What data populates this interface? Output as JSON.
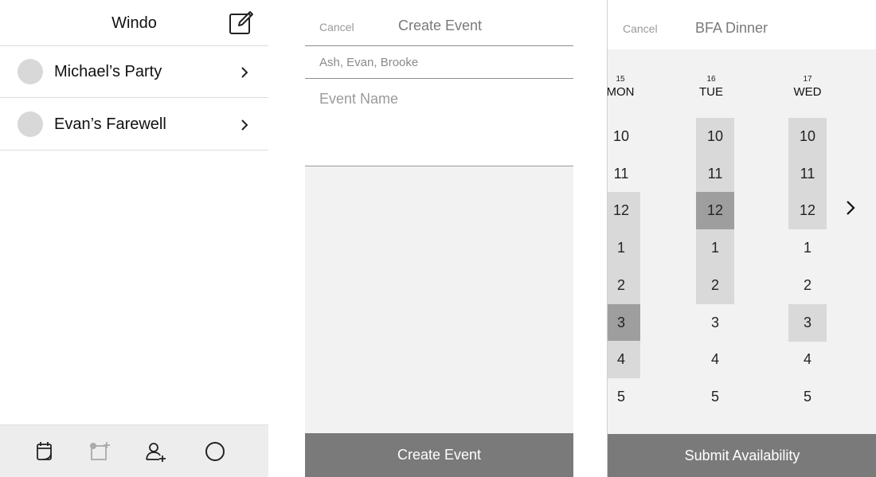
{
  "inbox": {
    "title": "Windo",
    "events": [
      {
        "name": "Michael’s Party"
      },
      {
        "name": "Evan’s Farewell"
      }
    ],
    "tabs": [
      {
        "icon": "calendar-icon"
      },
      {
        "icon": "add-event-icon"
      },
      {
        "icon": "add-person-icon"
      },
      {
        "icon": "circle-icon"
      }
    ]
  },
  "create_event": {
    "cancel_label": "Cancel",
    "title": "Create Event",
    "participants": "Ash, Evan, Brooke",
    "event_name_placeholder": "Event Name",
    "create_button": "Create Event"
  },
  "availability": {
    "cancel_label": "Cancel",
    "title": "BFA Dinner",
    "days": [
      {
        "num": "15",
        "name": "MON",
        "hours": [
          {
            "h": "10",
            "s": "none"
          },
          {
            "h": "11",
            "s": "none"
          },
          {
            "h": "12",
            "s": "available"
          },
          {
            "h": "1",
            "s": "available"
          },
          {
            "h": "2",
            "s": "available"
          },
          {
            "h": "3",
            "s": "selected"
          },
          {
            "h": "4",
            "s": "available"
          },
          {
            "h": "5",
            "s": "none"
          }
        ]
      },
      {
        "num": "16",
        "name": "TUE",
        "hours": [
          {
            "h": "10",
            "s": "available"
          },
          {
            "h": "11",
            "s": "available"
          },
          {
            "h": "12",
            "s": "selected"
          },
          {
            "h": "1",
            "s": "available"
          },
          {
            "h": "2",
            "s": "available"
          },
          {
            "h": "3",
            "s": "none"
          },
          {
            "h": "4",
            "s": "none"
          },
          {
            "h": "5",
            "s": "none"
          }
        ]
      },
      {
        "num": "17",
        "name": "WED",
        "hours": [
          {
            "h": "10",
            "s": "available"
          },
          {
            "h": "11",
            "s": "available"
          },
          {
            "h": "12",
            "s": "available"
          },
          {
            "h": "1",
            "s": "none"
          },
          {
            "h": "2",
            "s": "none"
          },
          {
            "h": "3",
            "s": "available"
          },
          {
            "h": "4",
            "s": "none"
          },
          {
            "h": "5",
            "s": "none"
          }
        ]
      }
    ],
    "submit_button": "Submit Availability"
  },
  "colors": {
    "button_bg": "#7a7a7a",
    "slot_available": "#d9d9d9",
    "slot_selected": "#9e9e9e",
    "panel_bg": "#f2f2f2"
  }
}
